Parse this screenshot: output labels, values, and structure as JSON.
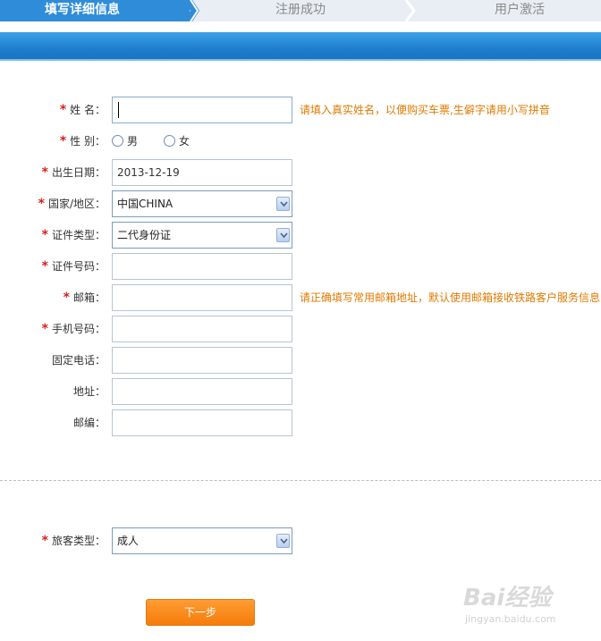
{
  "steps": [
    {
      "label": "填写详细信息",
      "active": true
    },
    {
      "label": "注册成功",
      "active": false
    },
    {
      "label": "用户激活",
      "active": false
    }
  ],
  "form": {
    "required_mark": "*",
    "name": {
      "label": "姓 名：",
      "value": "",
      "hint": "请填入真实姓名，以便购买车票,生僻字请用小写拼音"
    },
    "gender": {
      "label": "性 别：",
      "options": [
        "男",
        "女"
      ]
    },
    "birthdate": {
      "label": "出生日期：",
      "value": "2013-12-19"
    },
    "country": {
      "label": "国家/地区：",
      "value": "中国CHINA"
    },
    "id_type": {
      "label": "证件类型：",
      "value": "二代身份证"
    },
    "id_number": {
      "label": "证件号码：",
      "value": ""
    },
    "email": {
      "label": "邮箱：",
      "value": "",
      "hint": "请正确填写常用邮箱地址，默认使用邮箱接收铁路客户服务信息"
    },
    "mobile": {
      "label": "手机号码：",
      "value": ""
    },
    "phone": {
      "label": "固定电话：",
      "value": ""
    },
    "address": {
      "label": "地址：",
      "value": ""
    },
    "postcode": {
      "label": "邮编：",
      "value": ""
    },
    "passenger_type": {
      "label": "旅客类型：",
      "value": "成人"
    }
  },
  "next_button": "下一步",
  "watermark": {
    "logo": "Bai经验",
    "sub": "jingyan.baidu.com"
  },
  "colors": {
    "accent": "#2f8cd8",
    "hint": "#e07a00",
    "required": "#d42020",
    "button": "#f57c0b"
  }
}
